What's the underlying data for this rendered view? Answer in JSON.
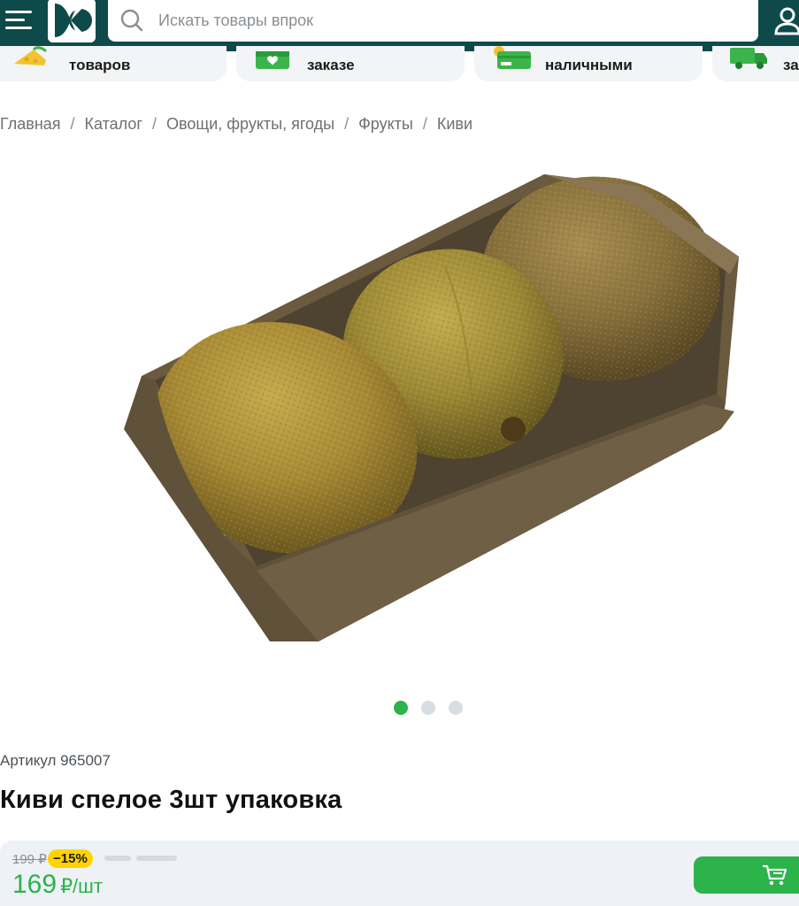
{
  "header": {
    "search_placeholder": "Искать товары впрок",
    "brand_color": "#0f4a4a",
    "icons": {
      "menu": "hamburger-menu-icon",
      "logo": "brand-logo",
      "search": "search-icon",
      "user": "user-icon"
    }
  },
  "promo": [
    {
      "label": "товаров",
      "icon": "cheese-icon"
    },
    {
      "label": "заказе",
      "icon": "gift-box-icon"
    },
    {
      "label": "наличными",
      "icon": "card-cash-icon"
    },
    {
      "label": "за",
      "icon": "delivery-truck-icon"
    }
  ],
  "breadcrumb": [
    "Главная",
    "Каталог",
    "Овощи, фрукты, ягоды",
    "Фрукты",
    "Киви"
  ],
  "breadcrumb_separator": "/",
  "gallery": {
    "count": 3,
    "active_index": 0
  },
  "product": {
    "article_label": "Артикул 965007",
    "title": "Киви спелое 3шт упаковка"
  },
  "price": {
    "old": "199 ₽",
    "discount": "−15%",
    "current": "169",
    "unit": "₽/шт",
    "accent_color": "#2cb34a",
    "badge_color": "#ffd400"
  },
  "cart_button": {
    "icon": "cart-icon"
  }
}
